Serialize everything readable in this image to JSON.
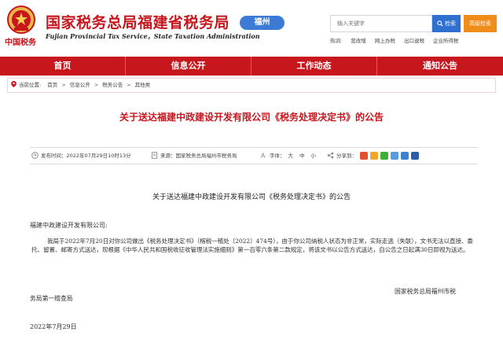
{
  "header": {
    "site_title": "国家税务总局福建省税务局",
    "site_subtitle": "Fujian Provincial Tax Service，State Taxation Administration",
    "brand_text": "中国税务",
    "city_badge": "福州",
    "search_placeholder": "输入关键字",
    "search_button": "检索",
    "advanced_button": "高级检索",
    "hotwords_label": "热词:",
    "hotwords": [
      "营改增",
      "网上办税",
      "出口退税",
      "企业所得税"
    ]
  },
  "nav": {
    "items": [
      "首页",
      "信息公开",
      "工作动态",
      "通知公告"
    ]
  },
  "breadcrumb": {
    "label": "当前位置:",
    "items": [
      "首页",
      "信息公开",
      "税务公告",
      "其他类"
    ]
  },
  "article": {
    "title": "关于送达福建中政建设开发有限公司《税务处理决定书》的公告",
    "publish_label": "发布时间：",
    "publish_time": "2022年07月29日10时13分",
    "source_label": "来源：",
    "source": "国家税务总局福州市税务局",
    "font_label": "字体：",
    "font_sizes": [
      "大",
      "中",
      "小"
    ],
    "share_label": "分享到："
  },
  "document": {
    "title": "关于送达福建中政建设开发有限公司《税务处理决定书》的公告",
    "salutation": "福建中政建设开发有限公司:",
    "body": "我局于2022年7月20日对你公司做出《税务处理决定书》（榕税一稽处〔2022〕474号），由于你公司纳税人状态为非正常，实际走逃（失联），文书无法以直接、委托、留置、邮寄方式送达，现根据《中华人民共和国税收征收管理法实施细则》第一百零六条第二款规定，将该文书以公告方式送达，自公告之日起满30日即视为送达。",
    "issuer_line1": "国家税务总局福州市税",
    "issuer_line2": "务局第一稽查局",
    "date": "2022年7月29日"
  },
  "colors": {
    "brand_red": "#c8161d",
    "badge_blue": "#3b7bd6",
    "search_blue": "#2f6fd0",
    "advanced_orange": "#f08c1a"
  }
}
